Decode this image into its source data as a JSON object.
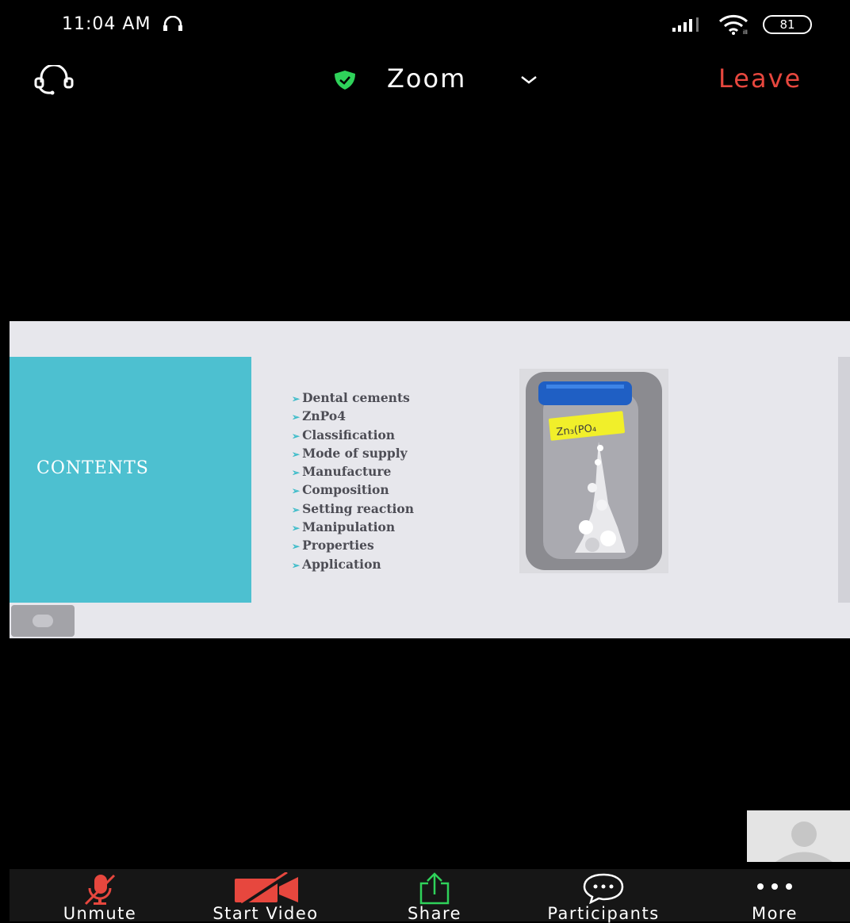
{
  "status_bar": {
    "time": "11:04 AM",
    "battery": "81",
    "icons": [
      "headphones-icon",
      "signal-icon",
      "wifi-icon",
      "battery-icon"
    ]
  },
  "top_bar": {
    "title": "Zoom",
    "leave_label": "Leave",
    "icons": [
      "audio-icon",
      "shield-icon",
      "chevron-down-icon"
    ],
    "colors": {
      "leave": "#e7473e",
      "shield": "#2fd25a"
    }
  },
  "shared_screen": {
    "slide": {
      "heading": "CONTENTS",
      "items": [
        "Dental cements",
        "ZnPo4",
        "Classification",
        "Mode of supply",
        "Manufacture",
        "Composition",
        "Setting reaction",
        "Manipulation",
        "Properties",
        "Application"
      ],
      "colors": {
        "heading_panel": "#4dc0d0",
        "bullet": "#3dbcc9"
      }
    }
  },
  "toolbar": {
    "buttons": [
      {
        "label": "Unmute",
        "icon": "mic-off-icon"
      },
      {
        "label": "Start Video",
        "icon": "video-off-icon"
      },
      {
        "label": "Share",
        "icon": "share-icon"
      },
      {
        "label": "Participants",
        "icon": "participants-icon"
      },
      {
        "label": "More",
        "icon": "more-icon"
      }
    ],
    "colors": {
      "muted": "#e7473e",
      "share": "#2fd25a"
    }
  }
}
